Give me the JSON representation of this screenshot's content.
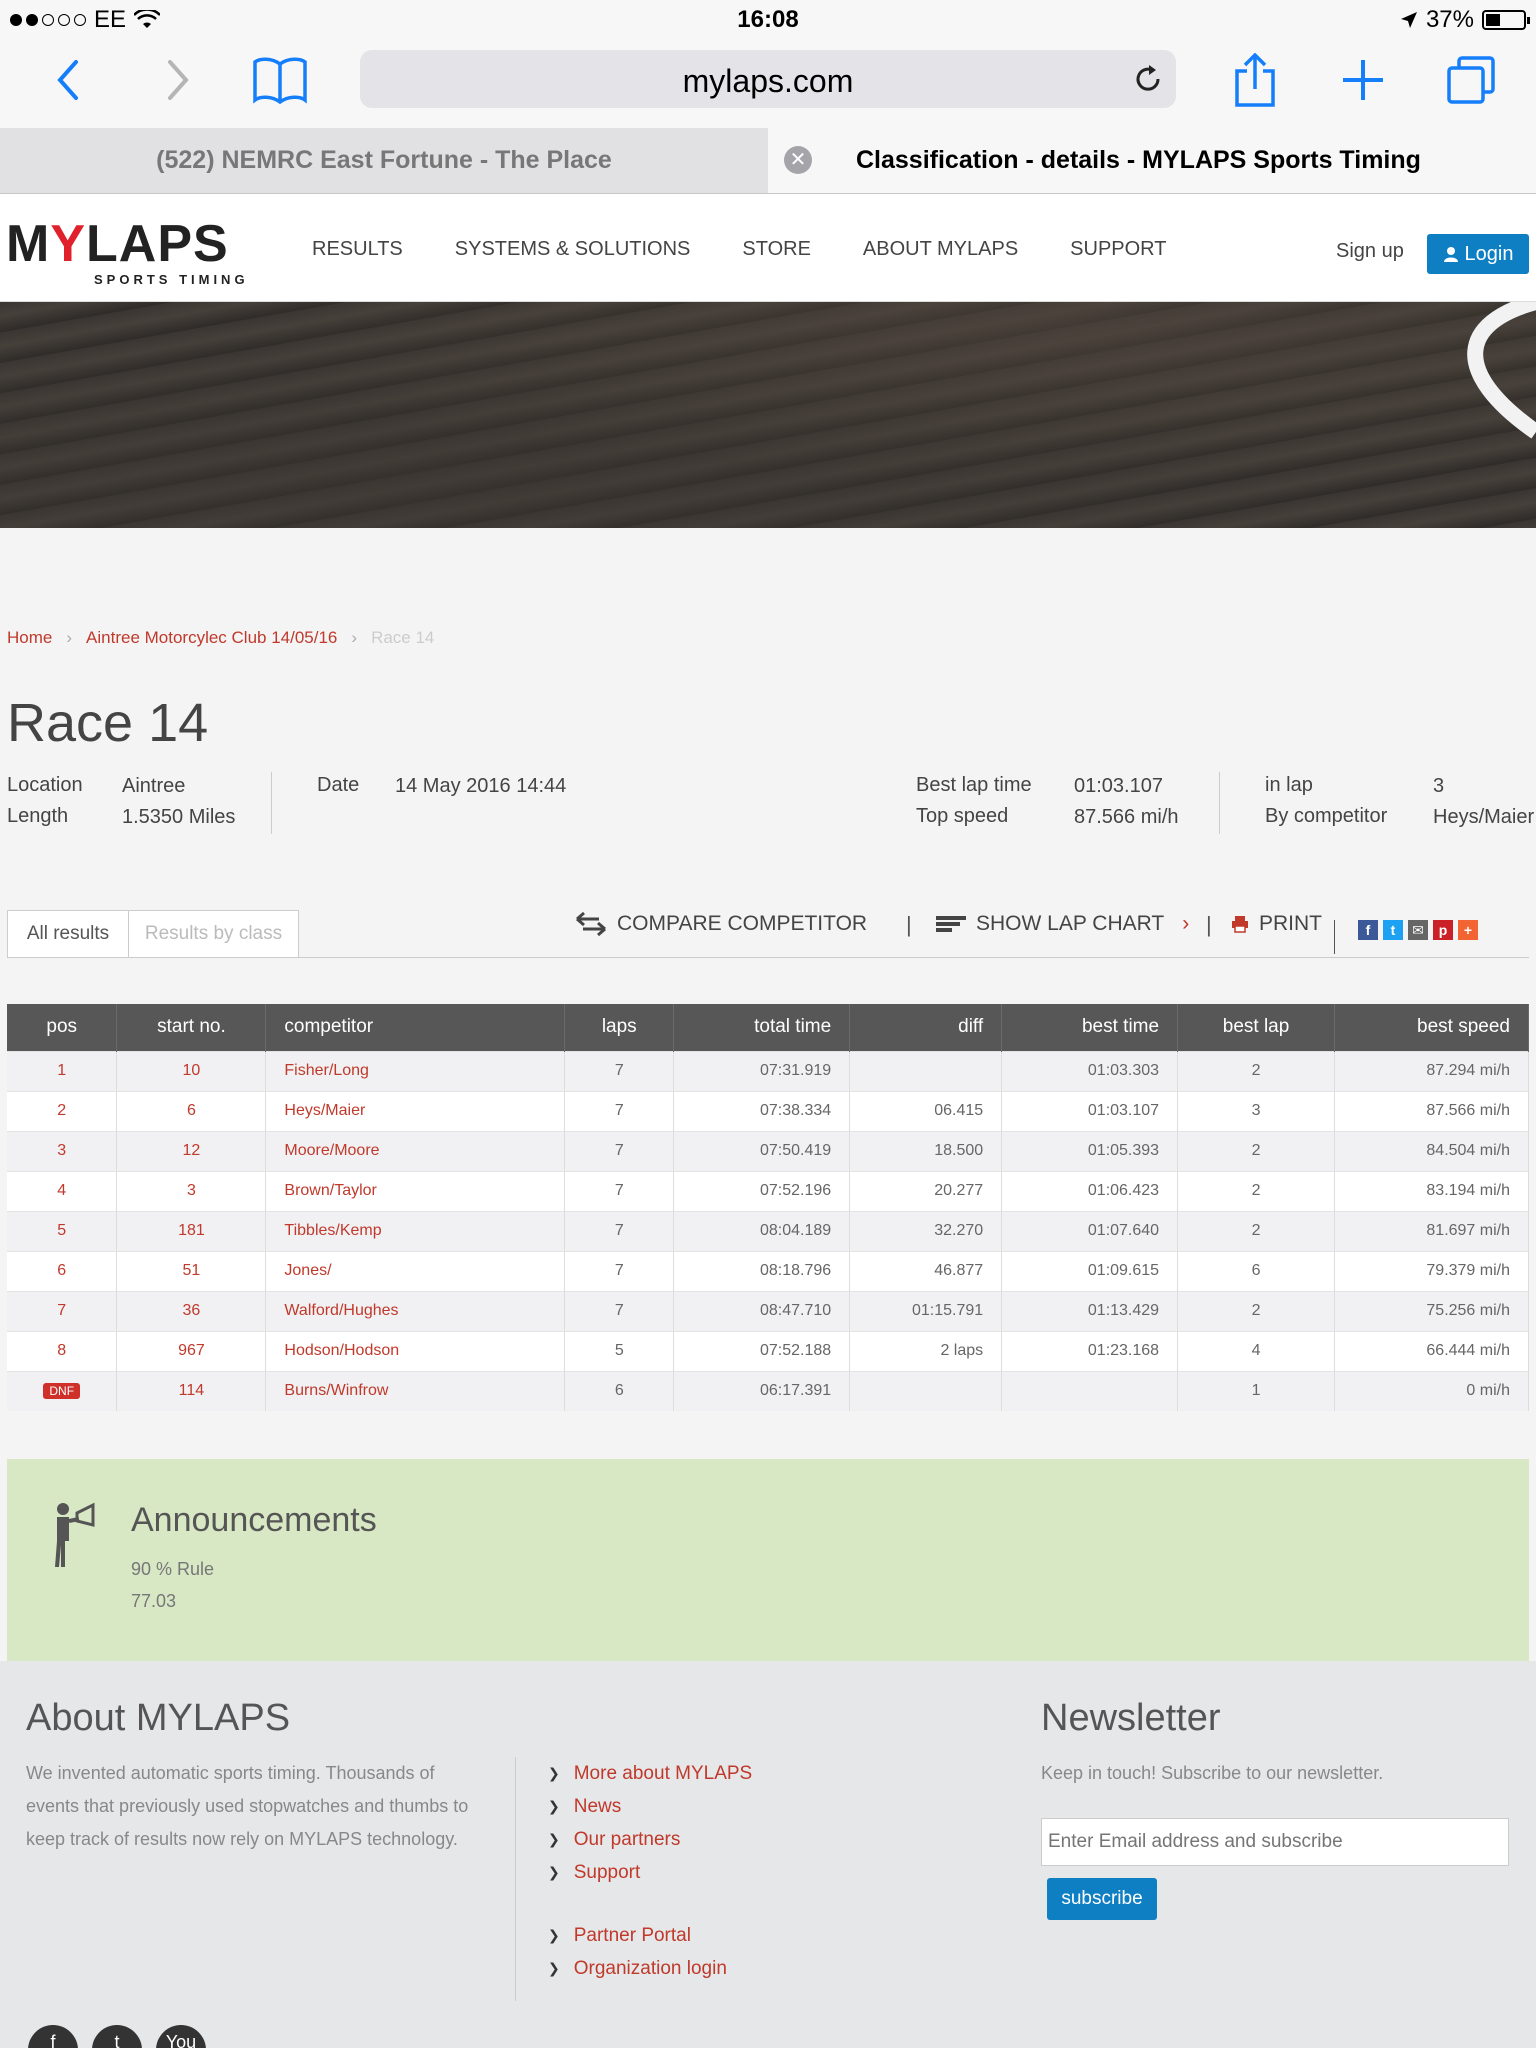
{
  "status_bar": {
    "carrier": "EE",
    "time": "16:08",
    "battery": "37%"
  },
  "browser": {
    "url": "mylaps.com",
    "tabs": [
      {
        "label": "(522) NEMRC East Fortune - The Place"
      },
      {
        "label": "Classification - details - MYLAPS Sports Timing"
      }
    ]
  },
  "header": {
    "logo_word": "MYLAPS",
    "logo_sub": "SPORTS TIMING",
    "nav": [
      "RESULTS",
      "SYSTEMS & SOLUTIONS",
      "STORE",
      "ABOUT MYLAPS",
      "SUPPORT"
    ],
    "signup": "Sign up",
    "login": "Login"
  },
  "breadcrumb": {
    "home": "Home",
    "event": "Aintree Motorcylec Club 14/05/16",
    "current": "Race 14"
  },
  "race": {
    "title": "Race 14",
    "location_label": "Location",
    "location": "Aintree",
    "length_label": "Length",
    "length": "1.5350 Miles",
    "date_label": "Date",
    "date": "14 May 2016 14:44",
    "best_lap_time_label": "Best lap time",
    "best_lap_time": "01:03.107",
    "top_speed_label": "Top speed",
    "top_speed": "87.566 mi/h",
    "in_lap_label": "in lap",
    "in_lap": "3",
    "by_competitor_label": "By competitor",
    "by_competitor": "Heys/Maier"
  },
  "results_tabs": {
    "all": "All results",
    "by_class": "Results by class"
  },
  "actions": {
    "compare": "COMPARE COMPETITOR",
    "lap_chart": "SHOW LAP CHART",
    "print": "PRINT",
    "separator": "|"
  },
  "table": {
    "headers": [
      "pos",
      "start no.",
      "competitor",
      "laps",
      "total time",
      "diff",
      "best time",
      "best lap",
      "best speed"
    ],
    "rows": [
      {
        "pos": "1",
        "start": "10",
        "competitor": "Fisher/Long",
        "laps": "7",
        "total": "07:31.919",
        "diff": "",
        "best_time": "01:03.303",
        "best_lap": "2",
        "best_speed": "87.294 mi/h"
      },
      {
        "pos": "2",
        "start": "6",
        "competitor": "Heys/Maier",
        "laps": "7",
        "total": "07:38.334",
        "diff": "06.415",
        "best_time": "01:03.107",
        "best_lap": "3",
        "best_speed": "87.566 mi/h"
      },
      {
        "pos": "3",
        "start": "12",
        "competitor": "Moore/Moore",
        "laps": "7",
        "total": "07:50.419",
        "diff": "18.500",
        "best_time": "01:05.393",
        "best_lap": "2",
        "best_speed": "84.504 mi/h"
      },
      {
        "pos": "4",
        "start": "3",
        "competitor": "Brown/Taylor",
        "laps": "7",
        "total": "07:52.196",
        "diff": "20.277",
        "best_time": "01:06.423",
        "best_lap": "2",
        "best_speed": "83.194 mi/h"
      },
      {
        "pos": "5",
        "start": "181",
        "competitor": "Tibbles/Kemp",
        "laps": "7",
        "total": "08:04.189",
        "diff": "32.270",
        "best_time": "01:07.640",
        "best_lap": "2",
        "best_speed": "81.697 mi/h"
      },
      {
        "pos": "6",
        "start": "51",
        "competitor": "Jones/",
        "laps": "7",
        "total": "08:18.796",
        "diff": "46.877",
        "best_time": "01:09.615",
        "best_lap": "6",
        "best_speed": "79.379 mi/h"
      },
      {
        "pos": "7",
        "start": "36",
        "competitor": "Walford/Hughes",
        "laps": "7",
        "total": "08:47.710",
        "diff": "01:15.791",
        "best_time": "01:13.429",
        "best_lap": "2",
        "best_speed": "75.256 mi/h"
      },
      {
        "pos": "8",
        "start": "967",
        "competitor": "Hodson/Hodson",
        "laps": "5",
        "total": "07:52.188",
        "diff": "2 laps",
        "best_time": "01:23.168",
        "best_lap": "4",
        "best_speed": "66.444 mi/h"
      },
      {
        "pos": "DNF",
        "start": "114",
        "competitor": "Burns/Winfrow",
        "laps": "6",
        "total": "06:17.391",
        "diff": "",
        "best_time": "",
        "best_lap": "1",
        "best_speed": "0 mi/h"
      }
    ]
  },
  "announcements": {
    "title": "Announcements",
    "line1": "90 % Rule",
    "line2": "77.03"
  },
  "footer": {
    "about_title": "About MYLAPS",
    "about_text": "We invented automatic sports timing. Thousands of events that previously used stopwatches and thumbs to keep track of results now rely on MYLAPS technology.",
    "links": [
      "More about MYLAPS",
      "News",
      "Our partners",
      "Support"
    ],
    "links2": [
      "Partner Portal",
      "Organization login"
    ],
    "newsletter_title": "Newsletter",
    "newsletter_text": "Keep in touch! Subscribe to our newsletter.",
    "email_placeholder": "Enter Email address and subscribe",
    "subscribe": "subscribe",
    "social_youtube": "You"
  },
  "colors": {
    "accent_red": "#c0392b",
    "brand_blue": "#0f7fc4",
    "table_header": "#575757",
    "announce_bg": "#d9e8c4"
  }
}
